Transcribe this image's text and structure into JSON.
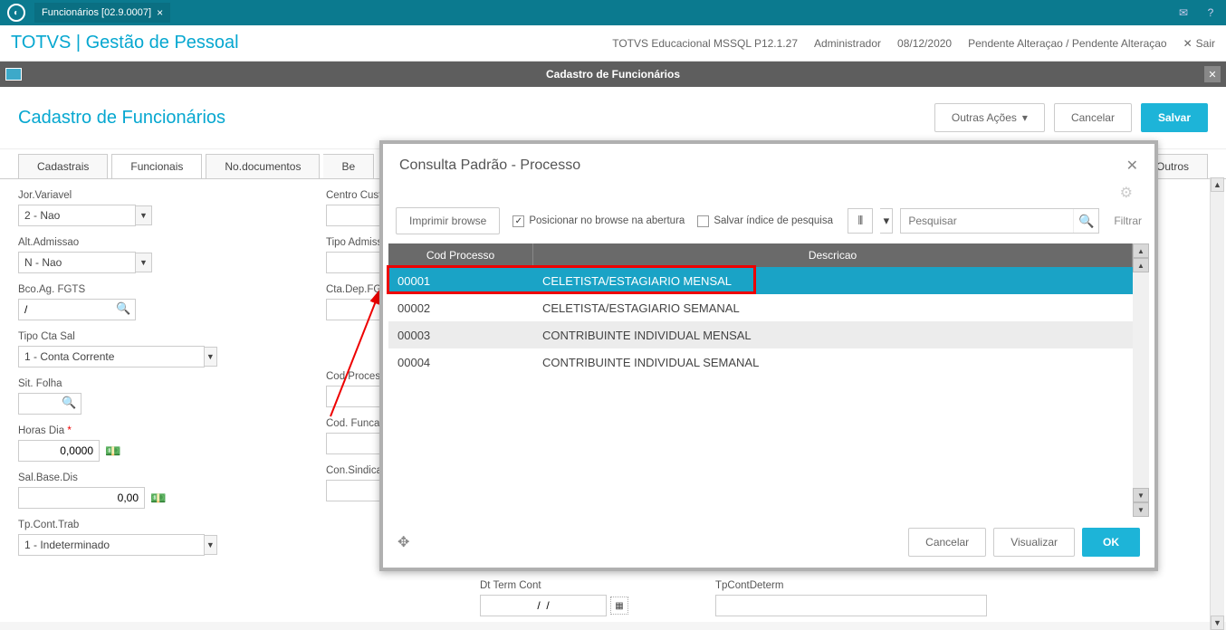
{
  "topbar": {
    "tab_title": "Funcionários [02.9.0007]",
    "tab_close": "×"
  },
  "header": {
    "app_title": "TOTVS | Gestão de Pessoal",
    "env": "TOTVS Educacional MSSQL P12.1.27",
    "user": "Administrador",
    "date": "08/12/2020",
    "status": "Pendente Alteraçao / Pendente Alteraçao",
    "exit": "Sair"
  },
  "windowbar": {
    "title": "Cadastro de Funcionários"
  },
  "page": {
    "title": "Cadastro de Funcionários",
    "actions": {
      "outras": "Outras Ações",
      "cancelar": "Cancelar",
      "salvar": "Salvar"
    }
  },
  "tabs": {
    "cadastrais": "Cadastrais",
    "funcionais": "Funcionais",
    "documentos": "No.documentos",
    "be": "Be",
    "outros": "Outros"
  },
  "form": {
    "jor_variavel_label": "Jor.Variavel",
    "jor_variavel_value": "2 - Nao",
    "alt_admissao_label": "Alt.Admissao",
    "alt_admissao_value": "N - Nao",
    "bco_fgts_label": "Bco.Ag. FGTS",
    "bco_fgts_value": "/",
    "tipo_cta_sal_label": "Tipo Cta Sal",
    "tipo_cta_sal_value": "1 - Conta Corrente",
    "sit_folha_label": "Sit. Folha",
    "horas_dia_label": "Horas Dia",
    "horas_dia_value": "0,0000",
    "sal_base_label": "Sal.Base.Dis",
    "sal_base_value": "0,00",
    "tp_cont_trab_label": "Tp.Cont.Trab",
    "tp_cont_trab_value": "1 - Indeterminado",
    "centro_custo_label": "Centro Custo",
    "tipo_admiss_label": "Tipo Admiss.",
    "cta_dep_fgts_label": "Cta.Dep.FGTS",
    "cod_processo_label": "Cod Processo",
    "cod_funcao_label": "Cod. Funcao",
    "con_sindical_label": "Con.Sindical",
    "dt_term_cont_label": "Dt Term Cont",
    "dt_term_cont_value": "/  /",
    "tp_cont_determ_label": "TpContDeterm"
  },
  "modal": {
    "title": "Consulta Padrão - Processo",
    "print": "Imprimir browse",
    "posicionar": "Posicionar no browse na abertura",
    "salvar_indice": "Salvar índice de pesquisa",
    "search_placeholder": "Pesquisar",
    "filtrar": "Filtrar",
    "col_cod": "Cod Processo",
    "col_desc": "Descricao",
    "rows": [
      {
        "cod": "00001",
        "desc": "CELETISTA/ESTAGIARIO MENSAL"
      },
      {
        "cod": "00002",
        "desc": "CELETISTA/ESTAGIARIO SEMANAL"
      },
      {
        "cod": "00003",
        "desc": "CONTRIBUINTE INDIVIDUAL MENSAL"
      },
      {
        "cod": "00004",
        "desc": "CONTRIBUINTE INDIVIDUAL SEMANAL"
      }
    ],
    "cancelar": "Cancelar",
    "visualizar": "Visualizar",
    "ok": "OK"
  }
}
